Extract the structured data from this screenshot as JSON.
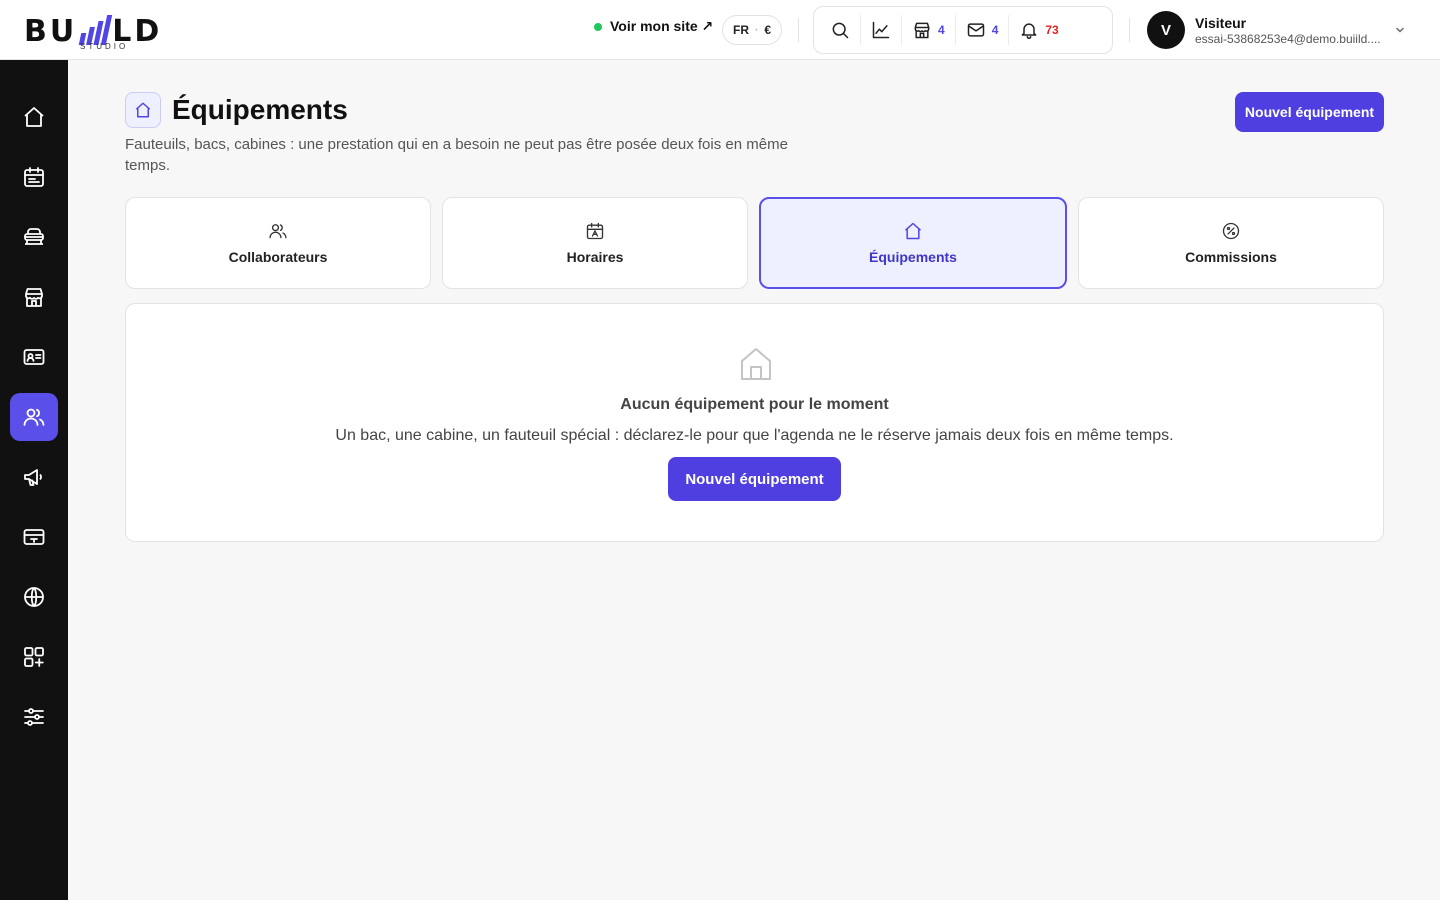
{
  "brand": {
    "logo_left": "BU",
    "logo_right": "LD",
    "logo_sub": "STUDIO"
  },
  "header": {
    "site_link": "Voir mon site ↗",
    "lang": "FR",
    "lang_sep": "·",
    "currency": "€",
    "tools": [
      {
        "icon": "search-icon"
      },
      {
        "icon": "chart-icon"
      },
      {
        "icon": "store-icon",
        "count": "4"
      },
      {
        "icon": "mail-icon",
        "count": "4"
      },
      {
        "icon": "bell-icon",
        "count": "73"
      }
    ],
    "user": {
      "initial": "V",
      "name": "Visiteur",
      "email": "essai-53868253e4@demo.buiild...."
    }
  },
  "sidebar": {
    "items": [
      {
        "icon": "home-icon"
      },
      {
        "icon": "calendar-icon"
      },
      {
        "icon": "chair-icon"
      },
      {
        "icon": "store-icon"
      },
      {
        "icon": "id-card-icon"
      },
      {
        "icon": "users-icon",
        "active": true
      },
      {
        "icon": "megaphone-icon"
      },
      {
        "icon": "register-icon"
      },
      {
        "icon": "globe-icon"
      },
      {
        "icon": "apps-add-icon"
      },
      {
        "icon": "sliders-icon"
      }
    ]
  },
  "page": {
    "title": "Équipements",
    "description": "Fauteuils, bacs, cabines : une prestation qui en a besoin ne peut pas être posée deux fois en même temps.",
    "new_button": "Nouvel équipement"
  },
  "tabs": [
    {
      "label": "Collaborateurs",
      "icon": "users-icon"
    },
    {
      "label": "Horaires",
      "icon": "calendar-icon"
    },
    {
      "label": "Équipements",
      "icon": "home-icon",
      "active": true
    },
    {
      "label": "Commissions",
      "icon": "percent-icon"
    }
  ],
  "empty_state": {
    "title": "Aucun équipement pour le moment",
    "text": "Un bac, une cabine, un fauteuil spécial : déclarez-le pour que l'agenda ne le réserve jamais deux fois en même temps.",
    "button": "Nouvel équipement"
  },
  "colors": {
    "accent": "#4f3fe0",
    "active_tab_bg": "#eef0ff",
    "sidebar_bg": "#111112",
    "status_dot": "#22c55e",
    "notif_badge": "#dc2626"
  }
}
